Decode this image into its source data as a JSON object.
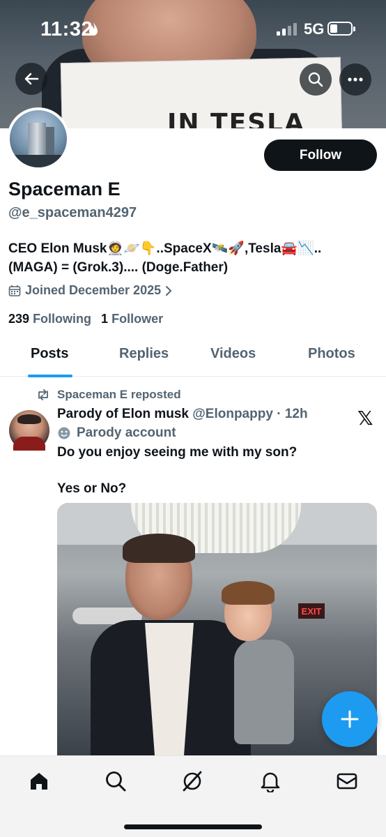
{
  "status_bar": {
    "time": "11:32",
    "network": "5G"
  },
  "banner": {
    "sign_text": "IN TESLA"
  },
  "profile": {
    "name": "Spaceman E",
    "handle": "@e_spaceman4297",
    "bio": "CEO Elon Musk🧑‍🚀🪐👇..SpaceX🛰️🚀,Tesla🚘📉..\n(MAGA) = (Grok.3).... (Doge.Father)",
    "joined": "Joined December 2025",
    "following_count": "239",
    "following_label": "Following",
    "followers_count": "1",
    "followers_label": "Follower",
    "follow_button": "Follow"
  },
  "tabs": [
    {
      "label": "Posts",
      "active": true
    },
    {
      "label": "Replies",
      "active": false
    },
    {
      "label": "Videos",
      "active": false
    },
    {
      "label": "Photos",
      "active": false
    }
  ],
  "post": {
    "repost_label": "Spaceman E reposted",
    "author_name": "Parody of Elon musk",
    "author_handle": "@Elonpappy",
    "separator": "·",
    "time_ago": "12h",
    "parody_label": "Parody account",
    "text": "Do you enjoy seeing me with my son?\n\nYes or No?",
    "media_sign": "EXIT"
  },
  "colors": {
    "accent": "#1d9bf0",
    "text_primary": "#0f1419",
    "text_secondary": "#536471"
  },
  "bottom_nav": [
    "home-icon",
    "search-icon",
    "grok-icon",
    "notifications-icon",
    "messages-icon"
  ]
}
